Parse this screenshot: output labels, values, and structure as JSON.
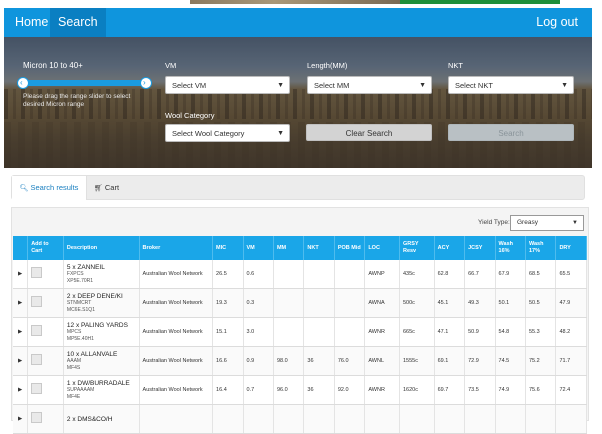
{
  "nav": {
    "home": "Home",
    "search": "Search",
    "logout": "Log out"
  },
  "filters": {
    "micron_title": "Micron 10 to 40+",
    "micron_help": "Please drag the range slider to select desired Micron range",
    "vm_label": "VM",
    "vm_value": "Select VM",
    "length_label": "Length(MM)",
    "length_value": "Select MM",
    "nkt_label": "NKT",
    "nkt_value": "Select NKT",
    "wool_label": "Wool Category",
    "wool_value": "Select Wool Category",
    "clear_button": "Clear Search",
    "search_button": "Search"
  },
  "tabs": {
    "results": "Search results",
    "cart": "Cart"
  },
  "yield": {
    "label": "Yield Type:",
    "value": "Greasy"
  },
  "table": {
    "headers": [
      "",
      "Add to Cart",
      "Description",
      "Broker",
      "MIC",
      "VM",
      "MM",
      "NKT",
      "POB Mid",
      "LOC",
      "GRSY Resv",
      "ACY",
      "JCSY",
      "Wash 16%",
      "Wash 17%",
      "DRY"
    ],
    "rows": [
      {
        "desc": "5 x ZANNEIL",
        "sub1": "FXPCS",
        "sub2": "XP5E.70R1",
        "broker": "Australian Wool Network",
        "mic": "26.5",
        "vm": "0.6",
        "mm": "",
        "nkt": "",
        "pob": "",
        "loc": "AWNP",
        "grsy": "435c",
        "acy": "62.8",
        "jcsy": "66.7",
        "w16": "67.9",
        "w17": "68.5",
        "dry": "65.5"
      },
      {
        "desc": "2 x DEEP DENE/KI",
        "sub1": "STNMCRT",
        "sub2": "MC6E.S1Q1",
        "broker": "Australian Wool Network",
        "mic": "19.3",
        "vm": "0.3",
        "mm": "",
        "nkt": "",
        "pob": "",
        "loc": "AWNA",
        "grsy": "500c",
        "acy": "45.1",
        "jcsy": "49.3",
        "w16": "50.1",
        "w17": "50.5",
        "dry": "47.9"
      },
      {
        "desc": "12 x PALING YARDS",
        "sub1": "MPCS",
        "sub2": "MP5E.40H1",
        "broker": "Australian Wool Network",
        "mic": "15.1",
        "vm": "3.0",
        "mm": "",
        "nkt": "",
        "pob": "",
        "loc": "AWNR",
        "grsy": "665c",
        "acy": "47.1",
        "jcsy": "50.9",
        "w16": "54.8",
        "w17": "55.3",
        "dry": "48.2"
      },
      {
        "desc": "10 x ALLANVALE",
        "sub1": "AAAM",
        "sub2": "MF4S",
        "broker": "Australian Wool Network",
        "mic": "16.6",
        "vm": "0.9",
        "mm": "98.0",
        "nkt": "36",
        "pob": "76.0",
        "loc": "AWNL",
        "grsy": "1555c",
        "acy": "69.1",
        "jcsy": "72.9",
        "w16": "74.5",
        "w17": "75.2",
        "dry": "71.7"
      },
      {
        "desc": "1 x DW/BURRADALE",
        "sub1": "SUPAAAAM",
        "sub2": "MF4E",
        "broker": "Australian Wool Network",
        "mic": "16.4",
        "vm": "0.7",
        "mm": "96.0",
        "nkt": "36",
        "pob": "92.0",
        "loc": "AWNR",
        "grsy": "1620c",
        "acy": "69.7",
        "jcsy": "73.5",
        "w16": "74.9",
        "w17": "75.6",
        "dry": "72.4"
      },
      {
        "desc": "2 x DMS&CO/H",
        "sub1": "",
        "sub2": "",
        "broker": "",
        "mic": "",
        "vm": "",
        "mm": "",
        "nkt": "",
        "pob": "",
        "loc": "",
        "grsy": "",
        "acy": "",
        "jcsy": "",
        "w16": "",
        "w17": "",
        "dry": ""
      }
    ]
  }
}
